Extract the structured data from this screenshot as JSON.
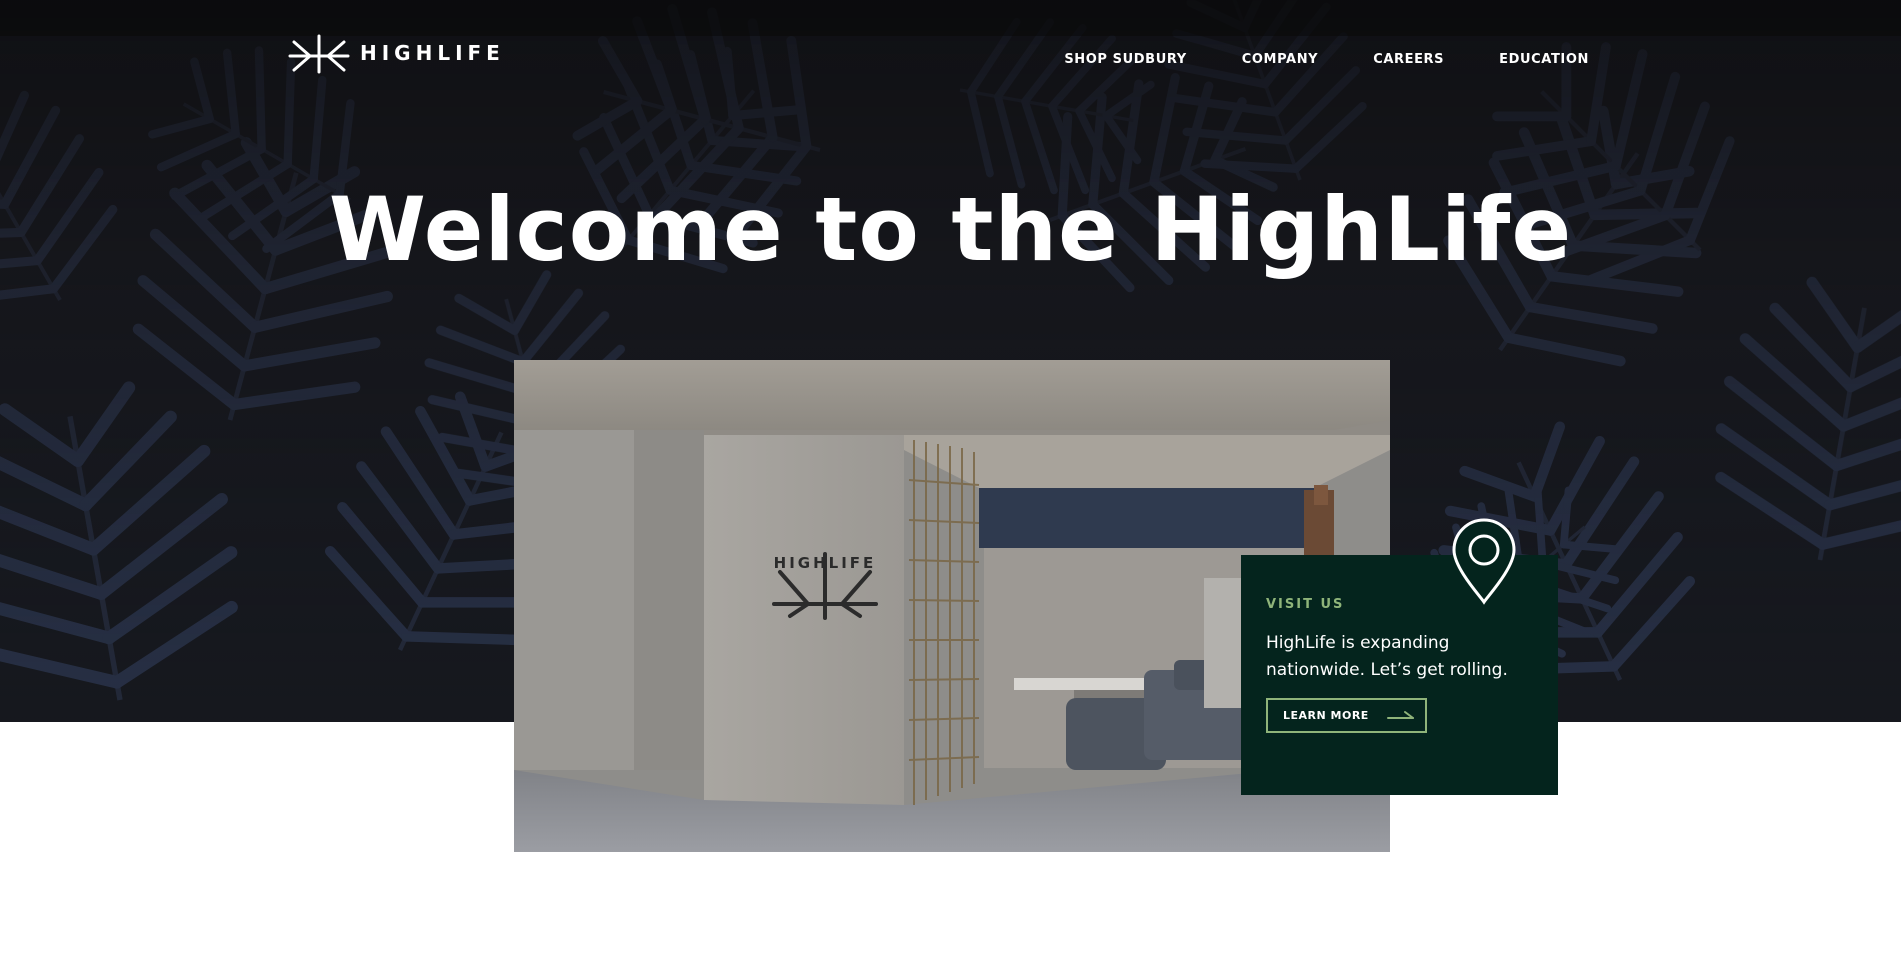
{
  "header": {
    "logo_text": "HIGHLIFE",
    "nav": [
      {
        "label": "SHOP SUDBURY"
      },
      {
        "label": "COMPANY"
      },
      {
        "label": "CAREERS"
      },
      {
        "label": "EDUCATION"
      }
    ]
  },
  "hero": {
    "headline": "Welcome to the HighLife"
  },
  "photo": {
    "wall_logo_text": "HIGHLIFE"
  },
  "visit_card": {
    "label": "VISIT US",
    "text": "HighLife is expanding nationwide. Let’s get rolling.",
    "button_label": "LEARN MORE"
  },
  "colors": {
    "hero_bg": "#17191f",
    "card_bg": "#04241d",
    "accent_green": "#8fb47a",
    "text_white": "#ffffff"
  },
  "icons": [
    "highlife-logo-icon",
    "location-pin-icon",
    "arrow-right-icon"
  ]
}
